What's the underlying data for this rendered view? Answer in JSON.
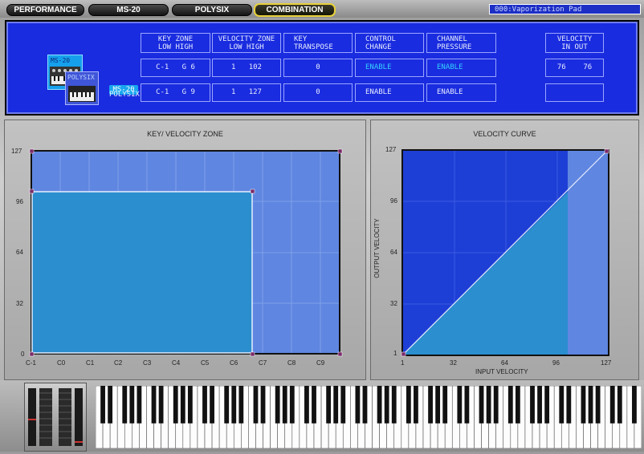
{
  "tabs": [
    {
      "label": "PERFORMANCE",
      "active": false
    },
    {
      "label": "MS-20",
      "active": false
    },
    {
      "label": "POLYSIX",
      "active": false
    },
    {
      "label": "COMBINATION",
      "active": true
    }
  ],
  "preset_name": "000:Vaporization Pad",
  "params": {
    "headers": {
      "key_zone": "KEY  ZONE",
      "key_zone_sub": "LOW    HIGH",
      "velocity_zone": "VELOCITY ZONE",
      "velocity_zone_sub": "LOW    HIGH",
      "key_transpose": "KEY",
      "key_transpose_sub": "TRANSPOSE",
      "control_change": "CONTROL",
      "control_change_sub": "CHANGE",
      "channel_pressure": "CHANNEL",
      "channel_pressure_sub": "PRESSURE",
      "velocity_io": "VELOCITY",
      "velocity_io_sub": "IN    OUT"
    },
    "rows": [
      {
        "name": "MS-20",
        "key_low": "C-1",
        "key_high": "G 6",
        "vel_low": "1",
        "vel_high": "102",
        "transpose": "0",
        "cc": "ENABLE",
        "pressure": "ENABLE",
        "vel_in": "76",
        "vel_out": "76"
      },
      {
        "name": "POLYSIX",
        "key_low": "C-1",
        "key_high": "G 9",
        "vel_low": "1",
        "vel_high": "127",
        "transpose": "0",
        "cc": "ENABLE",
        "pressure": "ENABLE",
        "vel_in": "",
        "vel_out": ""
      }
    ],
    "thumb_labels": [
      "MS-20",
      "POLYSIX"
    ]
  },
  "key_velocity_zone": {
    "title": "KEY/ VELOCITY ZONE",
    "y_ticks": [
      "127",
      "96",
      "64",
      "32",
      "0"
    ],
    "x_ticks": [
      "C-1",
      "C0",
      "C1",
      "C2",
      "C3",
      "C4",
      "C5",
      "C6",
      "C7",
      "C8",
      "C9"
    ]
  },
  "velocity_curve": {
    "title": "VELOCITY CURVE",
    "y_label": "OUTPUT VELOCITY",
    "x_label": "INPUT VELOCITY",
    "y_ticks": [
      "127",
      "96",
      "64",
      "32",
      "1"
    ],
    "x_ticks": [
      "1",
      "32",
      "64",
      "96",
      "127"
    ]
  }
}
